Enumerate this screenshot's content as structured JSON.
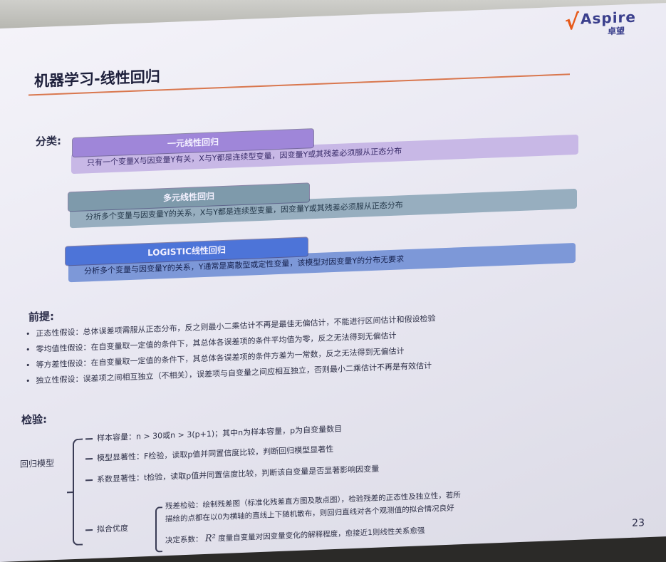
{
  "logo": {
    "brand": "Aspire",
    "brand_cn": "卓望"
  },
  "slide": {
    "title": "机器学习-线性回归",
    "section_classify": "分类:",
    "categories": [
      {
        "name": "一元线性回归",
        "desc": "只有一个变量X与因变量Y有关，X与Y都是连续型变量，因变量Y或其残差必须服从正态分布"
      },
      {
        "name": "多元线性回归",
        "desc": "分析多个变量与因变量Y的关系，X与Y都是连续型变量，因变量Y或其残差必须服从正态分布"
      },
      {
        "name": "LOGISTIC线性回归",
        "desc": "分析多个变量与因变量Y的关系，Y通常是离散型或定性变量，该模型对因变量Y的分布无要求"
      }
    ],
    "section_premise": "前提:",
    "premises": [
      "正态性假设：总体误差项需服从正态分布，反之则最小二乘估计不再是最佳无偏估计，不能进行区间估计和假设检验",
      "零均值性假设：在自变量取一定值的条件下，其总体各误差项的条件平均值为零，反之无法得到无偏估计",
      "等方差性假设：在自变量取一定值的条件下，其总体各误差项的条件方差为一常数，反之无法得到无偏估计",
      "独立性假设：误差项之间相互独立（不相关），误差项与自变量之间应相互独立，否则最小二乘估计不再是有效估计"
    ],
    "section_test": "检验:",
    "tree_root": "回归模型",
    "tests": [
      "样本容量：n > 30或n > 3(p+1)；其中n为样本容量，p为自变量数目",
      "模型显著性：F检验，读取p值并同置信度比较，判断回归模型显著性",
      "系数显著性：t检验，读取p值并同置信度比较，判断该自变量是否显著影响因变量"
    ],
    "fit": {
      "label": "拟合优度",
      "residual_1": "残差检验：绘制残差图（标准化残差直方图及散点图），检验残差的正态性及独立性，若所",
      "residual_2": "描绘的点都在以0为横轴的直线上下随机散布，则回归直线对各个观测值的拟合情况良好",
      "determination_label": "决定系数：",
      "r2_symbol": "R²",
      "determination_text": "度量自变量对因变量变化的解释程度，愈接近1则线性关系愈强"
    },
    "page_number": "23"
  }
}
